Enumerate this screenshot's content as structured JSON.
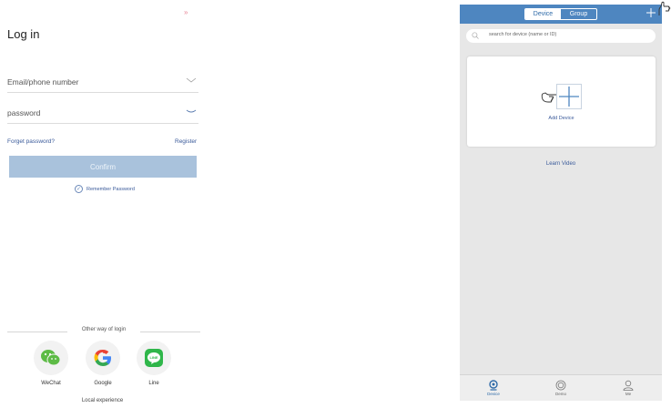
{
  "login": {
    "close_glyph": "»",
    "title": "Log in",
    "email_placeholder": "Email/phone number",
    "password_placeholder": "password",
    "forgot_password": "Forget password?",
    "register": "Register",
    "confirm": "Confirm",
    "remember_password": "Remember Password",
    "other_way": "Other way of login",
    "social": [
      {
        "label": "WeChat",
        "icon": "wechat-icon",
        "color": "#5dbb46"
      },
      {
        "label": "Google",
        "icon": "google-icon",
        "color": "#4285f4"
      },
      {
        "label": "Line",
        "icon": "line-icon",
        "color": "#2fb64a"
      }
    ],
    "local_experience": "Local experience"
  },
  "device_app": {
    "tabs_header": {
      "device": "Device",
      "group": "Group"
    },
    "search_placeholder": "search for device (name or ID)",
    "add_device": "Add Device",
    "learn_video": "Learn Video",
    "bottom_tabs": [
      {
        "label": "Device",
        "icon": "camera-icon"
      },
      {
        "label": "Demo",
        "icon": "demo-icon"
      },
      {
        "label": "Me",
        "icon": "user-icon"
      }
    ],
    "colors": {
      "header": "#4e86c0",
      "link": "#3a5a9a"
    }
  }
}
